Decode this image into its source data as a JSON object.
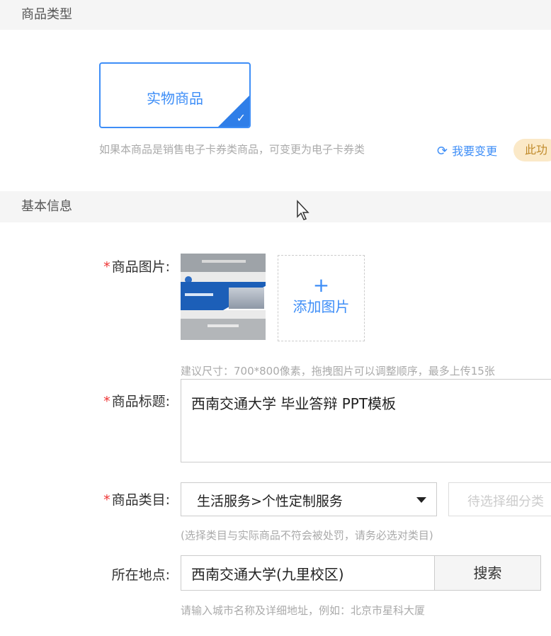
{
  "sections": {
    "product_type": "商品类型",
    "basic_info": "基本信息"
  },
  "product_type": {
    "selected_card": "实物商品",
    "hint": "如果本商品是销售电子卡券类商品，可变更为电子卡券类",
    "change_link": "我要变更",
    "feature_badge": "此功"
  },
  "form": {
    "image_label": "商品图片:",
    "add_image_label": "添加图片",
    "image_hint": "建议尺寸：700*800像素，拖拽图片可以调整顺序，最多上传15张",
    "title_label": "商品标题:",
    "title_value": "西南交通大学 毕业答辩 PPT模板",
    "category_label": "商品类目:",
    "category_value": "生活服务>个性定制服务",
    "subcategory_placeholder": "待选择细分类",
    "category_hint": "(选择类目与实际商品不符会被处罚，请务必选对类目)",
    "location_label": "所在地点:",
    "location_value": "西南交通大学(九里校区)",
    "search_button": "搜索",
    "location_hint": "请输入城市名称及详细地址，例如：北京市星科大厦",
    "required_mark": "*"
  },
  "icons": {
    "check": "check-icon",
    "refresh": "refresh-icon",
    "plus": "plus-icon",
    "caret": "caret-down-icon",
    "cursor": "mouse-cursor-icon"
  },
  "colors": {
    "accent": "#3e8ef7",
    "required": "#e33333",
    "badge_bg": "#fbe9c8"
  }
}
